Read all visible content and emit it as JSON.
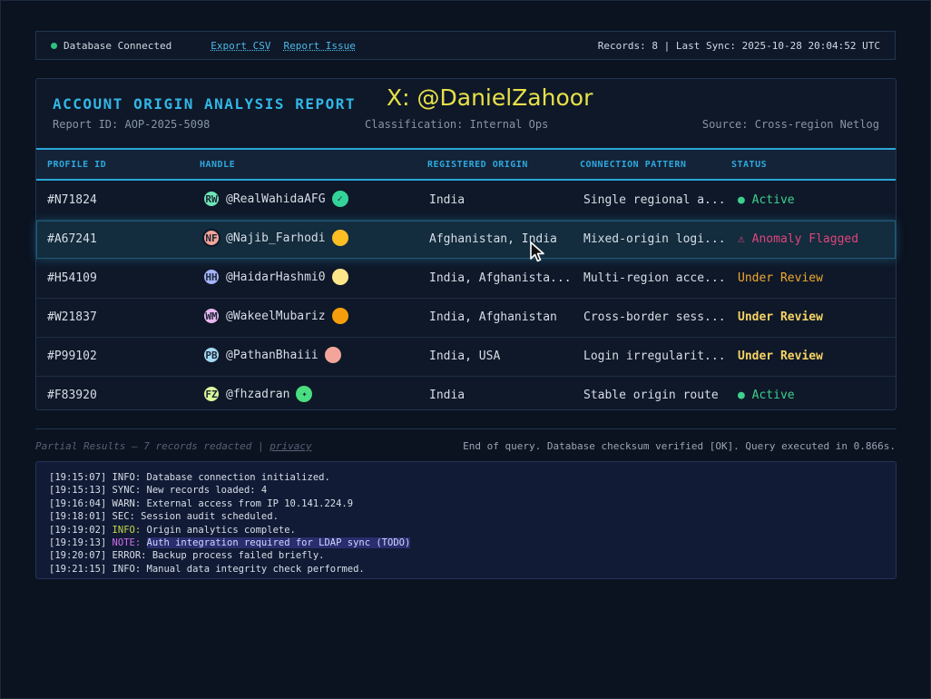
{
  "topbar": {
    "status": "Database Connected",
    "export_link": "Export CSV",
    "report_link": "Report Issue",
    "records_sync": "Records: 8 | Last Sync: 2025-10-28 20:04:52 UTC"
  },
  "report": {
    "title": "ACCOUNT ORIGIN ANALYSIS REPORT",
    "watermark": "X: @DanielZahoor",
    "report_id": "Report ID: AOP-2025-5098",
    "classification": "Classification: Internal Ops",
    "source": "Source: Cross-region Netlog"
  },
  "table": {
    "headers": [
      "PROFILE ID",
      "HANDLE",
      "REGISTERED ORIGIN",
      "CONNECTION PATTERN",
      "STATUS"
    ],
    "rows": [
      {
        "id": "#N71824",
        "initials": "RW",
        "avatar_color": "#6ee7b7",
        "handle": "@RealWahidaAFG",
        "badge_color": "#34d399",
        "badge_icon": "✓",
        "origin": "India",
        "pattern": "Single regional a...",
        "status": "● Active",
        "status_type": "active"
      },
      {
        "id": "#A67241",
        "initials": "NF",
        "avatar_color": "#f4a59a",
        "handle": "@Najib_Farhodi",
        "badge_color": "#fbbf24",
        "badge_icon": "",
        "origin": "Afghanistan, India",
        "pattern": "Mixed-origin logi...",
        "status": "⚠ Anomaly Flagged",
        "status_type": "anomaly"
      },
      {
        "id": "#H54109",
        "initials": "HH",
        "avatar_color": "#a5b4fc",
        "handle": "@HaidarHashmi0",
        "badge_color": "#fde68a",
        "badge_icon": "",
        "origin": "India, Afghanista...",
        "pattern": "Multi-region acce...",
        "status": "Under Review",
        "status_type": "review"
      },
      {
        "id": "#W21837",
        "initials": "WM",
        "avatar_color": "#e9b7f0",
        "handle": "@WakeelMubariz",
        "badge_color": "#f59e0b",
        "badge_icon": "",
        "origin": "India, Afghanistan",
        "pattern": "Cross-border sess...",
        "status": "Under Review",
        "status_type": "review-bold"
      },
      {
        "id": "#P99102",
        "initials": "PB",
        "avatar_color": "#a5d8f3",
        "handle": "@PathanBhaiii",
        "badge_color": "#f4a59a",
        "badge_icon": "",
        "origin": "India, USA",
        "pattern": "Login irregularit...",
        "status": "Under Review",
        "status_type": "review-bold"
      },
      {
        "id": "#F83920",
        "initials": "FZ",
        "avatar_color": "#d9f99d",
        "handle": "@fhzadran",
        "badge_color": "#4ade80",
        "badge_icon": "✦",
        "origin": "India",
        "pattern": "Stable origin route",
        "status": "● Active",
        "status_type": "active"
      }
    ]
  },
  "footer": {
    "partial": "Partial Results — 7 records redacted |",
    "privacy": "privacy",
    "query": "End of query. Database checksum verified [OK]. Query executed in 0.866s."
  },
  "log": [
    {
      "ts": "[19:15:07]",
      "level": "INFO",
      "msg": "Database connection initialized."
    },
    {
      "ts": "[19:15:13]",
      "level": "SYNC",
      "msg": "New records loaded: 4"
    },
    {
      "ts": "[19:16:04]",
      "level": "WARN",
      "msg": "External access from IP 10.141.224.9"
    },
    {
      "ts": "[19:18:01]",
      "level": "SEC",
      "msg": "Session audit scheduled."
    },
    {
      "ts": "[19:19:02]",
      "level": "INFO",
      "msg": "Origin analytics complete."
    },
    {
      "ts": "[19:19:13]",
      "level": "NOTE",
      "msg": "Auth integration required for LDAP sync (TODO)"
    },
    {
      "ts": "[19:20:07]",
      "level": "ERROR",
      "msg": "Backup process failed briefly."
    },
    {
      "ts": "[19:21:15]",
      "level": "INFO",
      "msg": "Manual data integrity check performed."
    }
  ],
  "colors": {
    "accent": "#33b6e6",
    "active": "#3ecf8e",
    "anomaly": "#e0457b",
    "review": "#f0a830",
    "review_bold": "#f6d365"
  }
}
